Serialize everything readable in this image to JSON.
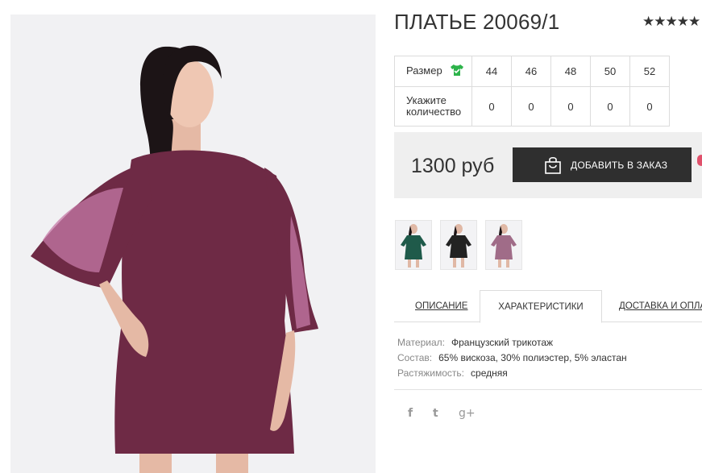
{
  "product": {
    "title": "ПЛАТЬЕ 20069/1",
    "rating_stars": "★★★★★"
  },
  "sizes": {
    "size_label": "Размер",
    "qty_label_line1": "Укажите",
    "qty_label_line2": "количество",
    "items": [
      {
        "size": "44",
        "qty": "0"
      },
      {
        "size": "46",
        "qty": "0"
      },
      {
        "size": "48",
        "qty": "0"
      },
      {
        "size": "50",
        "qty": "0"
      },
      {
        "size": "52",
        "qty": "0"
      }
    ],
    "shirt_icon_color": "#2db34a"
  },
  "purchase": {
    "price": "1300 руб",
    "order_button_label": "ДОБАВИТЬ В ЗАКАЗ"
  },
  "thumbnails": [
    {
      "icon": "dress-green-thumbnail",
      "color": "#1f5a4a"
    },
    {
      "icon": "dress-black-thumbnail",
      "color": "#222222"
    },
    {
      "icon": "dress-plum-thumbnail",
      "color": "#a06c88"
    }
  ],
  "tabs": [
    {
      "label": "ОПИСАНИЕ",
      "active": false
    },
    {
      "label": "ХАРАКТЕРИСТИКИ",
      "active": true
    },
    {
      "label": "ДОСТАВКА И ОПЛАТ",
      "active": false
    }
  ],
  "characteristics": [
    {
      "key": "Материал:",
      "value": "Французский трикотаж"
    },
    {
      "key": "Состав:",
      "value": "65% вискоза, 30% полиэстер, 5% эластан"
    },
    {
      "key": "Растяжимость:",
      "value": "средняя"
    }
  ],
  "social": {
    "facebook": "f",
    "twitter": "t",
    "googleplus": "g+"
  },
  "colors": {
    "dress": "#6e2a45",
    "button_bg": "#2f2f2f",
    "price_bar_bg": "#efefef",
    "accent_pink": "#e0506b"
  }
}
